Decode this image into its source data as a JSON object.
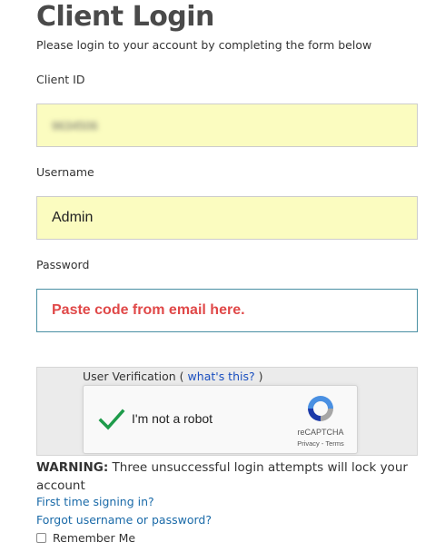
{
  "header": {
    "title": "Client Login",
    "subtitle": "Please login to your account by completing the form below"
  },
  "form": {
    "client_id": {
      "label": "Client ID",
      "value": "9634506"
    },
    "username": {
      "label": "Username",
      "value": "Admin"
    },
    "password": {
      "label": "Password",
      "value": "Paste code from email here."
    }
  },
  "verification": {
    "label_prefix": "User Verification (",
    "link": "what's this?",
    "label_suffix": ")",
    "recaptcha": {
      "checkbox_label": "I'm not a robot",
      "brand": "reCAPTCHA",
      "terms": "Privacy - Terms",
      "checked": true
    }
  },
  "warning": {
    "prefix": "WARNING:",
    "text": "Three unsuccessful login attempts will lock your account"
  },
  "links": {
    "first_time": "First time signing in?",
    "forgot": "Forgot username or password?"
  },
  "remember": {
    "label": "Remember Me",
    "checked": false
  },
  "colors": {
    "field_autofill": "#fbfcc0",
    "password_text": "#e04848",
    "link": "#1a6aa8",
    "check_green": "#1e9b4a"
  }
}
